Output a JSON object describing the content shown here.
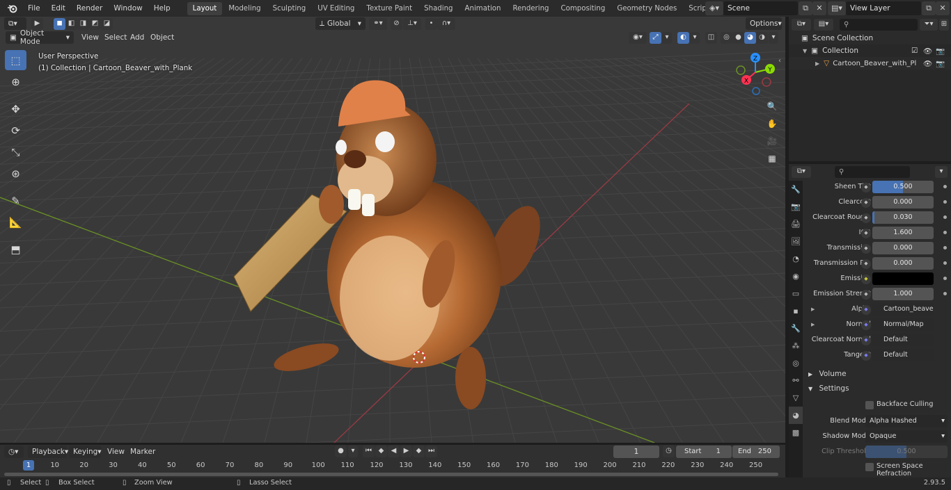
{
  "topbar": {
    "menus": [
      "File",
      "Edit",
      "Render",
      "Window",
      "Help"
    ],
    "workspaces": [
      "Layout",
      "Modeling",
      "Sculpting",
      "UV Editing",
      "Texture Paint",
      "Shading",
      "Animation",
      "Rendering",
      "Compositing",
      "Geometry Nodes",
      "Scripting"
    ],
    "active_workspace": "Layout",
    "scene": "Scene",
    "view_layer": "View Layer"
  },
  "viewport": {
    "mode": "Object Mode",
    "menus": [
      "View",
      "Select",
      "Add",
      "Object"
    ],
    "transform_orientation": "Global",
    "options_label": "Options",
    "perspective_label": "User Perspective",
    "collection_label": "(1) Collection | Cartoon_Beaver_with_Plank",
    "gizmo_axes": [
      "X",
      "Y",
      "Z"
    ]
  },
  "outliner": {
    "scene_collection": "Scene Collection",
    "collection": "Collection",
    "object": "Cartoon_Beaver_with_Pl"
  },
  "properties": {
    "rows": [
      {
        "label": "Sheen Tint",
        "value": "0.500",
        "fill": 0.5
      },
      {
        "label": "Clearcoat",
        "value": "0.000",
        "fill": 0
      },
      {
        "label": "Clearcoat Roug...",
        "value": "0.030",
        "fill": 0.03
      },
      {
        "label": "IOR",
        "value": "1.600",
        "fill": 0
      },
      {
        "label": "Transmission",
        "value": "0.000",
        "fill": 0
      },
      {
        "label": "Transmission R...",
        "value": "0.000",
        "fill": 0
      },
      {
        "label": "Emission",
        "value": "",
        "color": "#000000"
      },
      {
        "label": "Emission Strengt",
        "value": "1.000",
        "fill": 0
      },
      {
        "label": "Alpha",
        "value": "Cartoon_beaver_Re..."
      },
      {
        "label": "Normal",
        "value": "Normal/Map"
      },
      {
        "label": "Clearcoat Normal",
        "value": "Default"
      },
      {
        "label": "Tangent",
        "value": "Default"
      }
    ],
    "volume_section": "Volume",
    "settings_section": "Settings",
    "backface_culling": "Backface Culling",
    "blend_mode_label": "Blend Mode",
    "blend_mode_value": "Alpha Hashed",
    "shadow_mode_label": "Shadow Mode",
    "shadow_mode_value": "Opaque",
    "clip_threshold_label": "Clip Threshold",
    "clip_threshold_value": "0.500",
    "ssr_label": "Screen Space Refraction"
  },
  "timeline": {
    "menus": [
      "Playback",
      "Keying",
      "View",
      "Marker"
    ],
    "current_frame": "1",
    "start_label": "Start",
    "start_value": "1",
    "end_label": "End",
    "end_value": "250",
    "ruler": [
      "1",
      "10",
      "20",
      "30",
      "40",
      "50",
      "60",
      "70",
      "80",
      "90",
      "100",
      "110",
      "120",
      "130",
      "140",
      "150",
      "160",
      "170",
      "180",
      "190",
      "200",
      "210",
      "220",
      "230",
      "240",
      "250"
    ]
  },
  "statusbar": {
    "select": "Select",
    "box_select": "Box Select",
    "zoom_view": "Zoom View",
    "lasso_select": "Lasso Select",
    "version": "2.93.5"
  },
  "colors": {
    "accent": "#4772b3",
    "viewport_bg": "#393939",
    "x_axis": "#ff3352",
    "y_axis": "#8bdc00",
    "z_axis": "#2890ff"
  }
}
